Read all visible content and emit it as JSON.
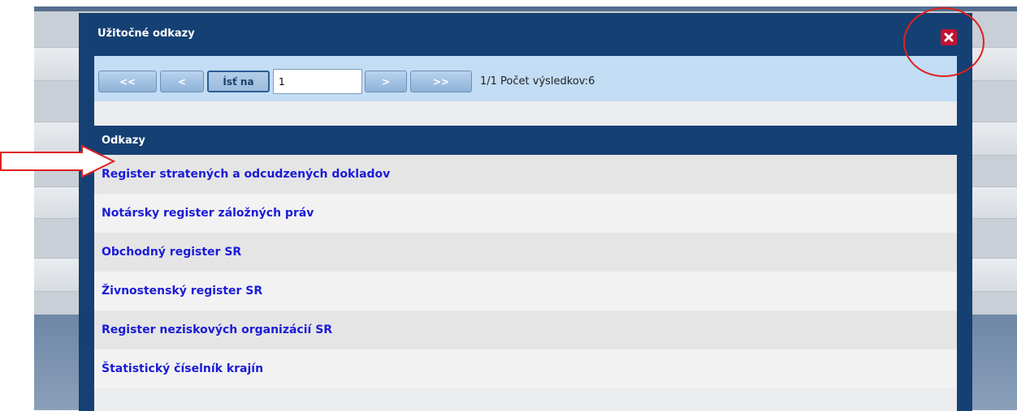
{
  "modal": {
    "title": "Užitočné odkazy",
    "close_icon": "close-icon",
    "accent_color": "#154073",
    "close_color": "#c4122f"
  },
  "pager": {
    "first_label": "<<",
    "prev_label": "<",
    "go_label": "Ísť na",
    "page_value": "1",
    "next_label": ">",
    "last_label": ">>",
    "info": "1/1 Počet výsledkov:6"
  },
  "table": {
    "column_header": "Odkazy",
    "rows": [
      "Register stratených a odcudzených dokladov",
      "Notársky register záložných práv",
      "Obchodný register SR",
      "Živnostenský register SR",
      "Register neziskových organizácií SR",
      "Štatistický číselník krajín"
    ]
  },
  "annotations": {
    "arrow_icon": "red-outline-arrow-icon",
    "circle_icon": "red-circle-highlight-icon",
    "color": "#e02020"
  }
}
